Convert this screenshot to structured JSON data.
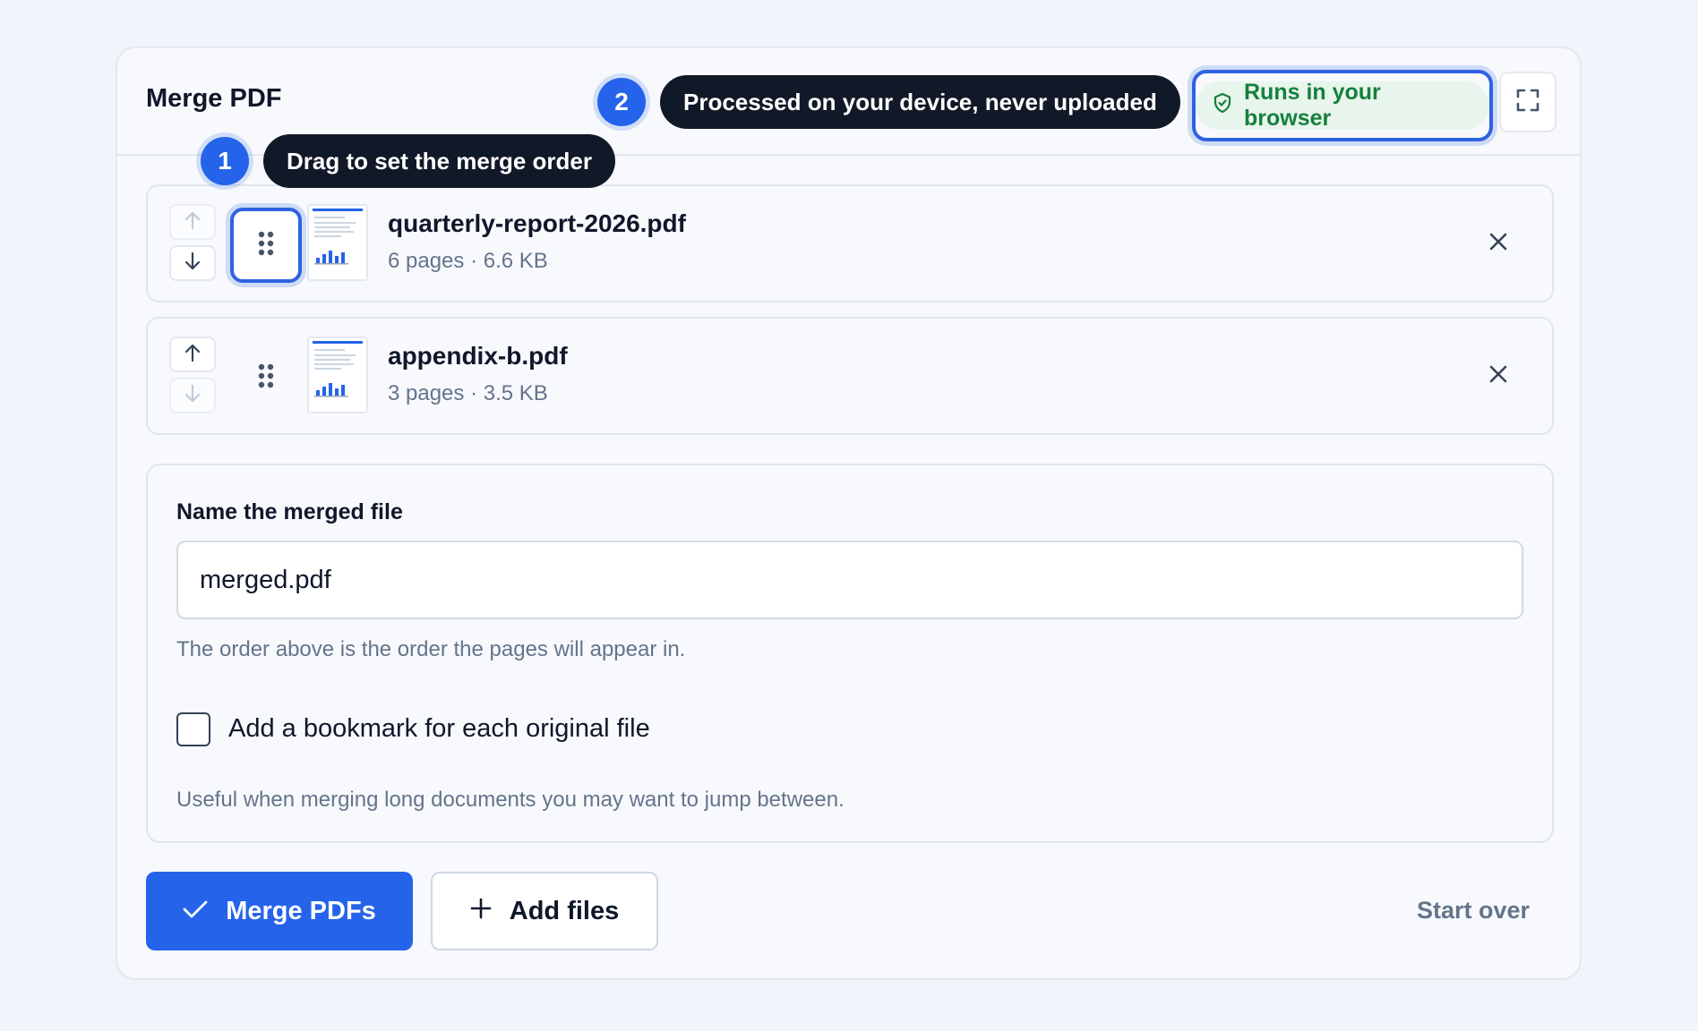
{
  "header": {
    "title": "Merge PDF",
    "privacy_badge": "Runs in your browser"
  },
  "callouts": [
    {
      "number": "1",
      "text": "Drag to set the merge order"
    },
    {
      "number": "2",
      "text": "Processed on your device, never uploaded"
    }
  ],
  "files": [
    {
      "name": "quarterly-report-2026.pdf",
      "meta": "6 pages · 6.6 KB"
    },
    {
      "name": "appendix-b.pdf",
      "meta": "3 pages · 3.5 KB"
    }
  ],
  "options": {
    "name_label": "Name the merged file",
    "name_value": "merged.pdf",
    "order_hint": "The order above is the order the pages will appear in.",
    "bookmark_label": "Add a bookmark for each original file",
    "bookmark_checked": false,
    "bookmark_hint": "Useful when merging long documents you may want to jump between."
  },
  "actions": {
    "merge_label": "Merge PDFs",
    "add_label": "Add files",
    "start_over_label": "Start over"
  },
  "colors": {
    "accent": "#2563eb",
    "tooltip_bg": "#111827",
    "success": "#15803d"
  }
}
